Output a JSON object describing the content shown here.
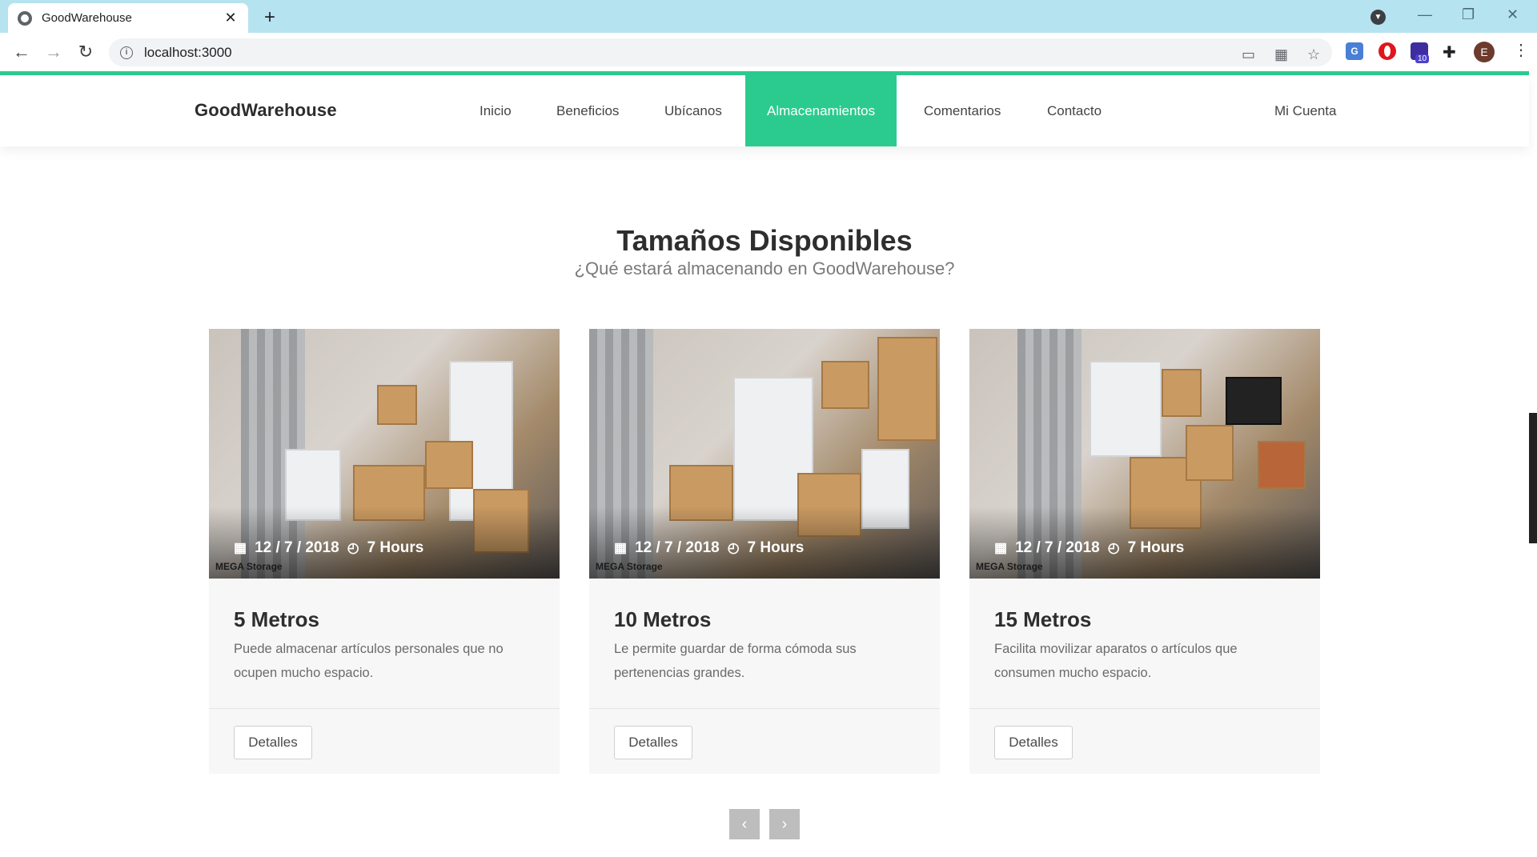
{
  "browser": {
    "tab_title": "GoodWarehouse",
    "tab_close": "✕",
    "new_tab": "+",
    "url": "localhost:3000",
    "info_glyph": "i",
    "back": "←",
    "forward": "→",
    "reload": "↻",
    "minimize": "—",
    "restore": "❐",
    "close": "✕",
    "translate_badge": "G",
    "extension_badge": "10",
    "avatar_letter": "E",
    "menu": "⋮"
  },
  "nav": {
    "brand": "GoodWarehouse",
    "links": [
      "Inicio",
      "Beneficios",
      "Ubícanos",
      "Almacenamientos",
      "Comentarios",
      "Contacto"
    ],
    "active": "Almacenamientos",
    "account": "Mi Cuenta"
  },
  "section": {
    "title": "Tamaños Disponibles",
    "subtitle": "¿Qué estará almacenando en GoodWarehouse?"
  },
  "cards": [
    {
      "date": "12 / 7 / 2018",
      "time": "7 Hours",
      "logo": "MEGA Storage",
      "name": "5 Metros",
      "description": "Puede almacenar artículos personales que no ocupen mucho espacio.",
      "button": "Detalles"
    },
    {
      "date": "12 / 7 / 2018",
      "time": "7 Hours",
      "logo": "MEGA Storage",
      "name": "10 Metros",
      "description": "Le permite guardar de forma cómoda sus pertenencias grandes.",
      "button": "Detalles"
    },
    {
      "date": "12 / 7 / 2018",
      "time": "7 Hours",
      "logo": "MEGA Storage",
      "name": "15 Metros",
      "description": "Facilita movilizar aparatos o artículos que consumen mucho espacio.",
      "button": "Detalles"
    }
  ],
  "carousel": {
    "prev": "‹",
    "next": "›"
  },
  "colors": {
    "accent": "#2bcb8f",
    "tabbar": "#b6e3f0"
  },
  "icons": {
    "calendar": "calendar-icon",
    "clock": "clock-icon"
  }
}
